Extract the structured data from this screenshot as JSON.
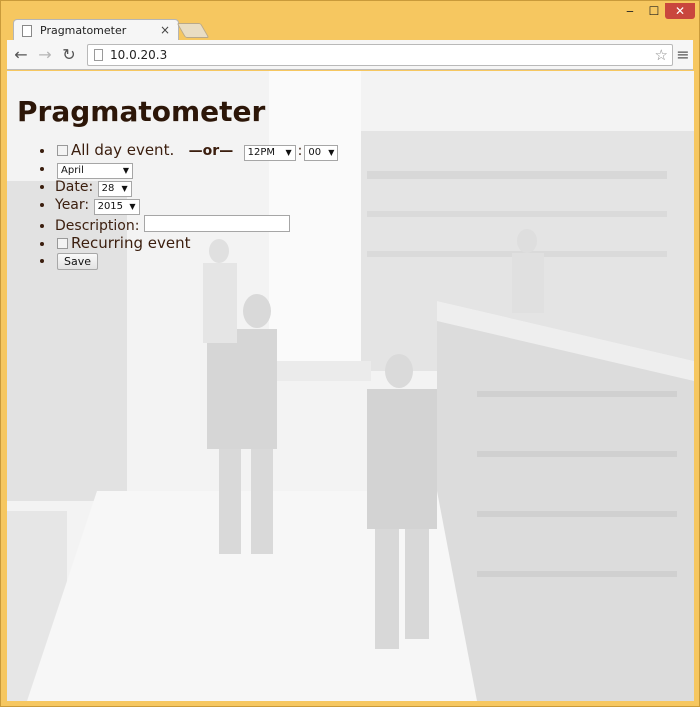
{
  "browser": {
    "tab_title": "Pragmatometer",
    "tab_close": "×",
    "url": "10.0.20.3",
    "window_controls": {
      "minimize": "‒",
      "maximize": "☐",
      "close": "✕"
    }
  },
  "page": {
    "title": "Pragmatometer",
    "form": {
      "all_day_label": "All day event.",
      "or_label": "—or—",
      "hour_value": "12PM",
      "time_separator": ":",
      "minute_value": "00",
      "month_value": "April",
      "date_label": "Date:",
      "date_value": "28",
      "year_label": "Year:",
      "year_value": "2015",
      "description_label": "Description:",
      "recurring_label": "Recurring event",
      "save_label": "Save"
    }
  },
  "icons": {
    "back": "arrow-left-icon",
    "forward": "arrow-right-icon",
    "reload": "reload-icon",
    "bookmark": "star-icon",
    "menu": "hamburger-menu-icon"
  },
  "colors": {
    "window_frame": "#f6c760",
    "heading_text": "#2c1608",
    "close_button": "#c9463d"
  }
}
